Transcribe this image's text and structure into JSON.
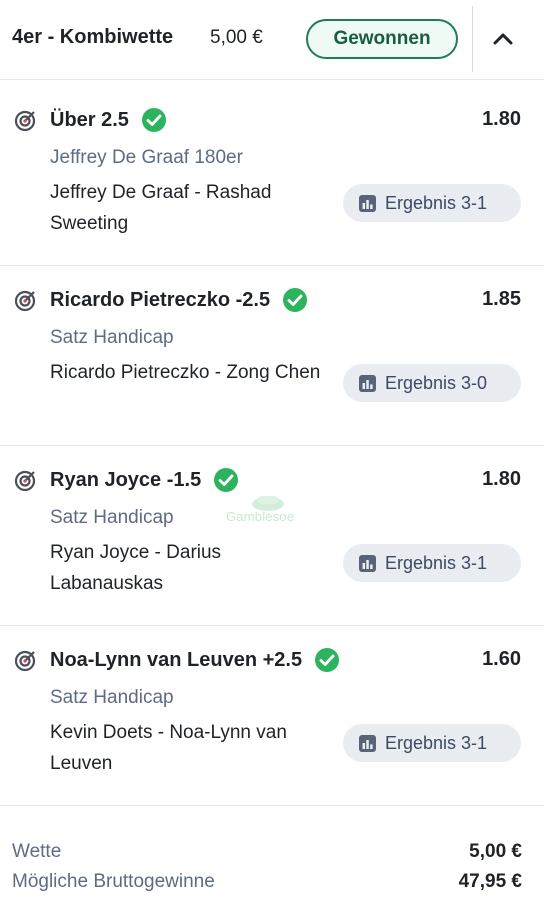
{
  "header": {
    "title": "4er - Kombiwette",
    "stake": "5,00 €",
    "status": "Gewonnen",
    "collapse_icon": "chevron-up-icon"
  },
  "legs": [
    {
      "selection": "Über 2.5",
      "odds": "1.80",
      "market": "Jeffrey De Graaf 180er",
      "event": "Jeffrey De Graaf - Rashad Sweeting",
      "result": "Ergebnis 3-1"
    },
    {
      "selection": "Ricardo Pietreczko -2.5",
      "odds": "1.85",
      "market": "Satz Handicap",
      "event": "Ricardo Pietreczko - Zong Chen",
      "result": "Ergebnis 3-0"
    },
    {
      "selection": "Ryan Joyce -1.5",
      "odds": "1.80",
      "market": "Satz Handicap",
      "event": "Ryan Joyce - Darius Labanauskas",
      "result": "Ergebnis 3-1"
    },
    {
      "selection": "Noa-Lynn van Leuven +2.5",
      "odds": "1.60",
      "market": "Satz Handicap",
      "event": "Kevin Doets - Noa-Lynn van Leuven",
      "result": "Ergebnis 3-1"
    }
  ],
  "footer": {
    "stake_label": "Wette",
    "stake_value": "5,00 €",
    "payout_label": "Mögliche Bruttogewinne",
    "payout_value": "47,95 €"
  },
  "watermark": "Gamblesoe",
  "colors": {
    "won_green": "#1e7d55",
    "check_green": "#2db35d",
    "muted_text": "#5e6b85",
    "result_chip": "#e9ecf1"
  }
}
